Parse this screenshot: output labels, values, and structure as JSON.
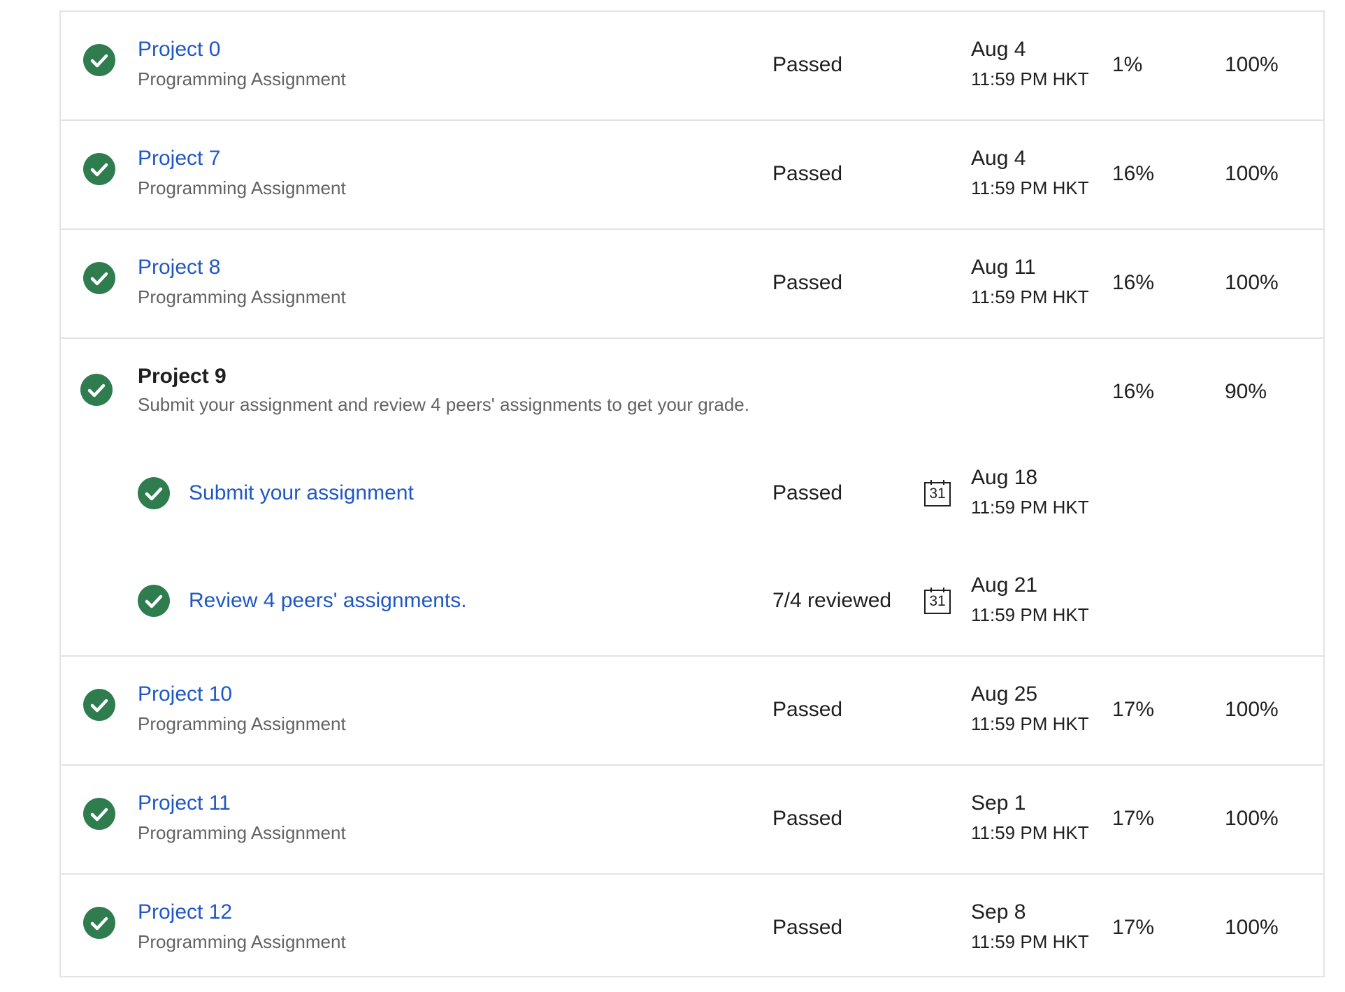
{
  "rows": [
    {
      "title": "Project 0",
      "subtitle": "Programming Assignment",
      "status": "Passed",
      "due_date": "Aug 4",
      "due_time": "11:59 PM HKT",
      "weight": "1%",
      "grade": "100%"
    },
    {
      "title": "Project 7",
      "subtitle": "Programming Assignment",
      "status": "Passed",
      "due_date": "Aug 4",
      "due_time": "11:59 PM HKT",
      "weight": "16%",
      "grade": "100%"
    },
    {
      "title": "Project 8",
      "subtitle": "Programming Assignment",
      "status": "Passed",
      "due_date": "Aug 11",
      "due_time": "11:59 PM HKT",
      "weight": "16%",
      "grade": "100%"
    }
  ],
  "peer_project": {
    "title": "Project 9",
    "subtitle": "Submit your assignment and review 4 peers' assignments to get your grade.",
    "weight": "16%",
    "grade": "90%",
    "tasks": [
      {
        "title": "Submit your assignment",
        "status": "Passed",
        "calendar_icon": "calendar-icon",
        "calendar_day": "31",
        "due_date": "Aug 18",
        "due_time": "11:59 PM HKT"
      },
      {
        "title": "Review 4 peers' assignments.",
        "status": "7/4 reviewed",
        "calendar_icon": "calendar-icon",
        "calendar_day": "31",
        "due_date": "Aug 21",
        "due_time": "11:59 PM HKT"
      }
    ]
  },
  "rows_after": [
    {
      "title": "Project 10",
      "subtitle": "Programming Assignment",
      "status": "Passed",
      "due_date": "Aug 25",
      "due_time": "11:59 PM HKT",
      "weight": "17%",
      "grade": "100%"
    },
    {
      "title": "Project 11",
      "subtitle": "Programming Assignment",
      "status": "Passed",
      "due_date": "Sep 1",
      "due_time": "11:59 PM HKT",
      "weight": "17%",
      "grade": "100%"
    },
    {
      "title": "Project 12",
      "subtitle": "Programming Assignment",
      "status": "Passed",
      "due_date": "Sep 8",
      "due_time": "11:59 PM HKT",
      "weight": "17%",
      "grade": "100%"
    }
  ],
  "icons": {
    "completed": "check-circle-icon",
    "calendar": "calendar-icon"
  },
  "colors": {
    "check": "#2f7d4f",
    "link": "#1f57c5",
    "border": "#e3e3e3",
    "subtitle": "#636363"
  }
}
